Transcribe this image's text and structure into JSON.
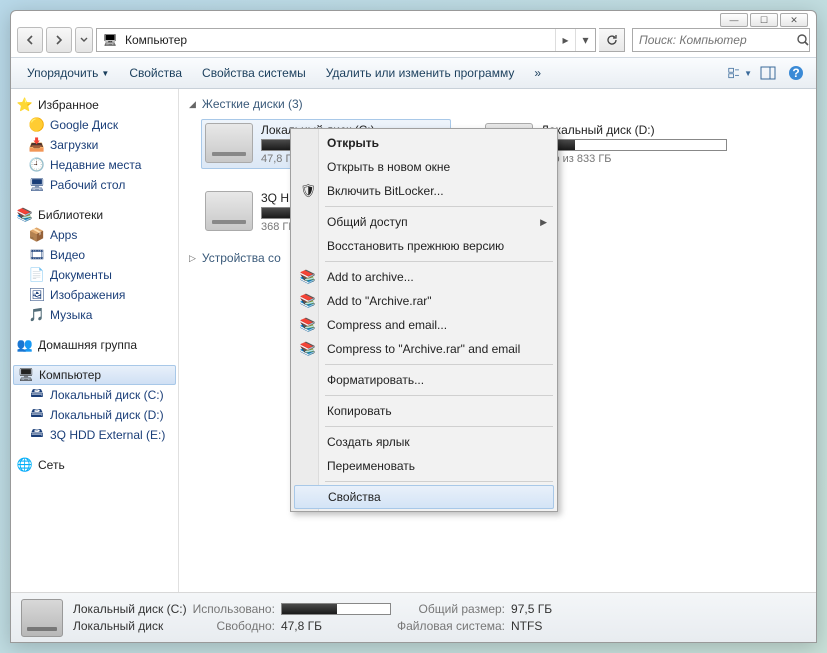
{
  "window_controls": {
    "min": "—",
    "max": "☐",
    "close": "✕"
  },
  "address": {
    "location": "Компьютер"
  },
  "search": {
    "placeholder": "Поиск: Компьютер"
  },
  "toolbar": {
    "organize": "Упорядочить",
    "properties": "Свойства",
    "system_properties": "Свойства системы",
    "uninstall": "Удалить или изменить программу",
    "more": "»"
  },
  "sidebar": {
    "favorites": {
      "label": "Избранное",
      "items": [
        {
          "icon": "🟡",
          "label": "Google Диск"
        },
        {
          "icon": "📥",
          "label": "Загрузки"
        },
        {
          "icon": "🕘",
          "label": "Недавние места"
        },
        {
          "icon": "🖥",
          "label": "Рабочий стол"
        }
      ]
    },
    "libraries": {
      "label": "Библиотеки",
      "items": [
        {
          "icon": "📦",
          "label": "Apps"
        },
        {
          "icon": "🎞",
          "label": "Видео"
        },
        {
          "icon": "📄",
          "label": "Документы"
        },
        {
          "icon": "🖼",
          "label": "Изображения"
        },
        {
          "icon": "🎵",
          "label": "Музыка"
        }
      ]
    },
    "homegroup": {
      "label": "Домашняя группа"
    },
    "computer": {
      "label": "Компьютер",
      "items": [
        {
          "icon": "🖴",
          "label": "Локальный диск (C:)"
        },
        {
          "icon": "🖴",
          "label": "Локальный диск (D:)"
        },
        {
          "icon": "🖴",
          "label": "3Q HDD External (E:)"
        }
      ]
    },
    "network": {
      "label": "Сеть"
    }
  },
  "content": {
    "section_hdd": "Жесткие диски (3)",
    "section_removable": "Устройства со",
    "drives": [
      {
        "name": "Локальный диск (C:)",
        "free": "47,8 ГБ с",
        "fill_pct": 51
      },
      {
        "name": "Локальный диск (D:)",
        "free": "дно из 833 ГБ",
        "fill_pct": 18
      },
      {
        "name": "3Q HDD",
        "free": "368 ГБ с",
        "fill_pct": 60
      }
    ]
  },
  "context_menu": {
    "open": "Открыть",
    "open_new": "Открыть в новом окне",
    "bitlocker": "Включить BitLocker...",
    "sharing": "Общий доступ",
    "restore": "Восстановить прежнюю версию",
    "add_archive": "Add to archive...",
    "add_archive_rar": "Add to \"Archive.rar\"",
    "compress_email": "Compress and email...",
    "compress_rar_email": "Compress to \"Archive.rar\" and email",
    "format": "Форматировать...",
    "copy": "Копировать",
    "shortcut": "Создать ярлык",
    "rename": "Переименовать",
    "properties": "Свойства"
  },
  "statusbar": {
    "title": "Локальный диск (C:)",
    "used_label": "Использовано:",
    "total_label": "Общий размер:",
    "total_value": "97,5 ГБ",
    "drive_label2": "Локальный диск",
    "free_label": "Свободно:",
    "free_value": "47,8 ГБ",
    "fs_label": "Файловая система:",
    "fs_value": "NTFS",
    "used_fill_pct": 51
  }
}
